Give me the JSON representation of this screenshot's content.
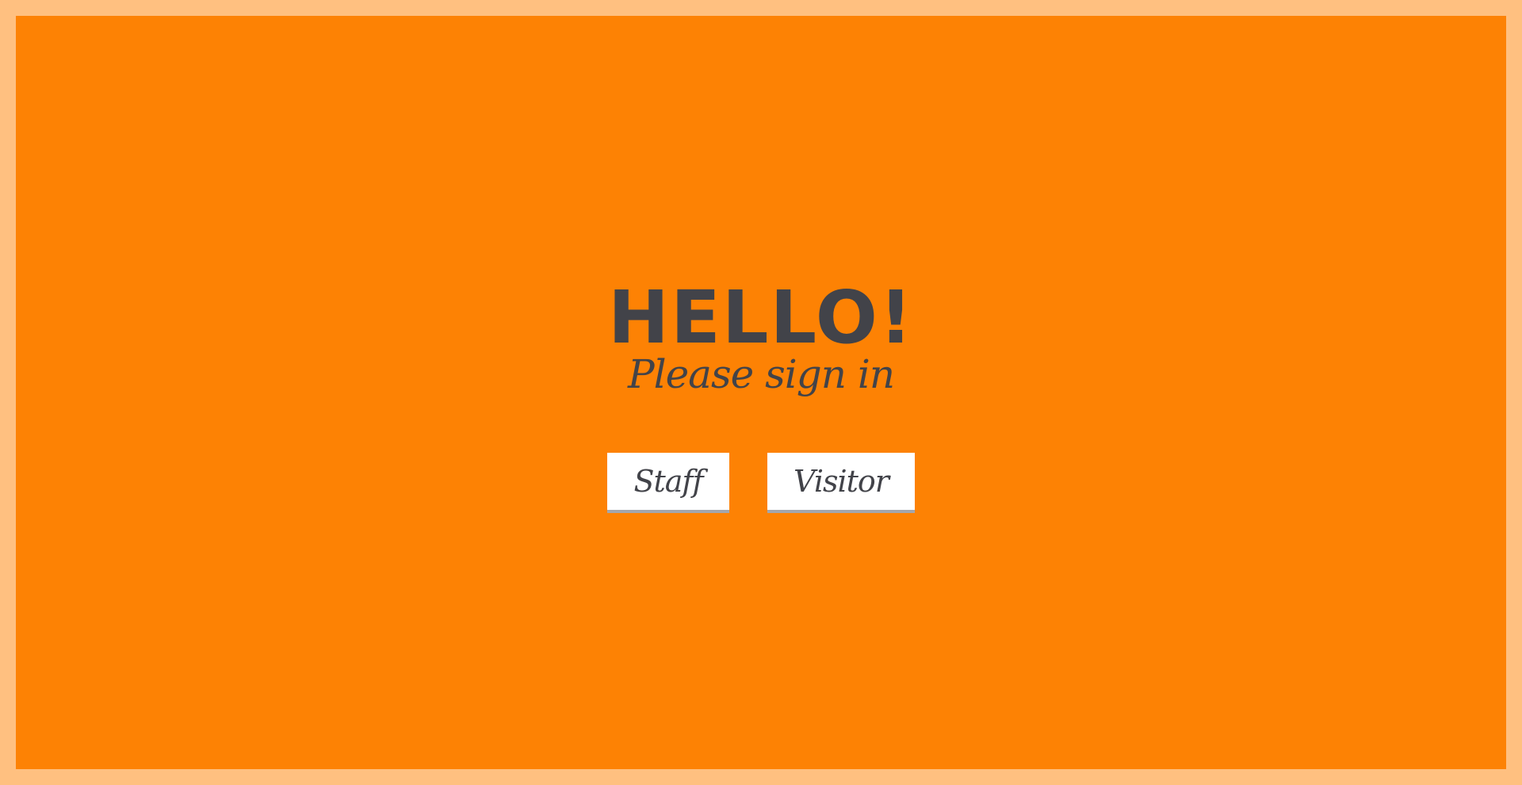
{
  "page": {
    "heading": "HELLO!",
    "subheading": "Please sign in"
  },
  "actions": {
    "staff_label": "Staff",
    "visitor_label": "Visitor"
  },
  "colors": {
    "outer_border": "#FFC080",
    "background": "#FD8204",
    "text": "#424349",
    "button_bg": "#FFFFFF",
    "button_shadow": "#A3A6AD"
  }
}
